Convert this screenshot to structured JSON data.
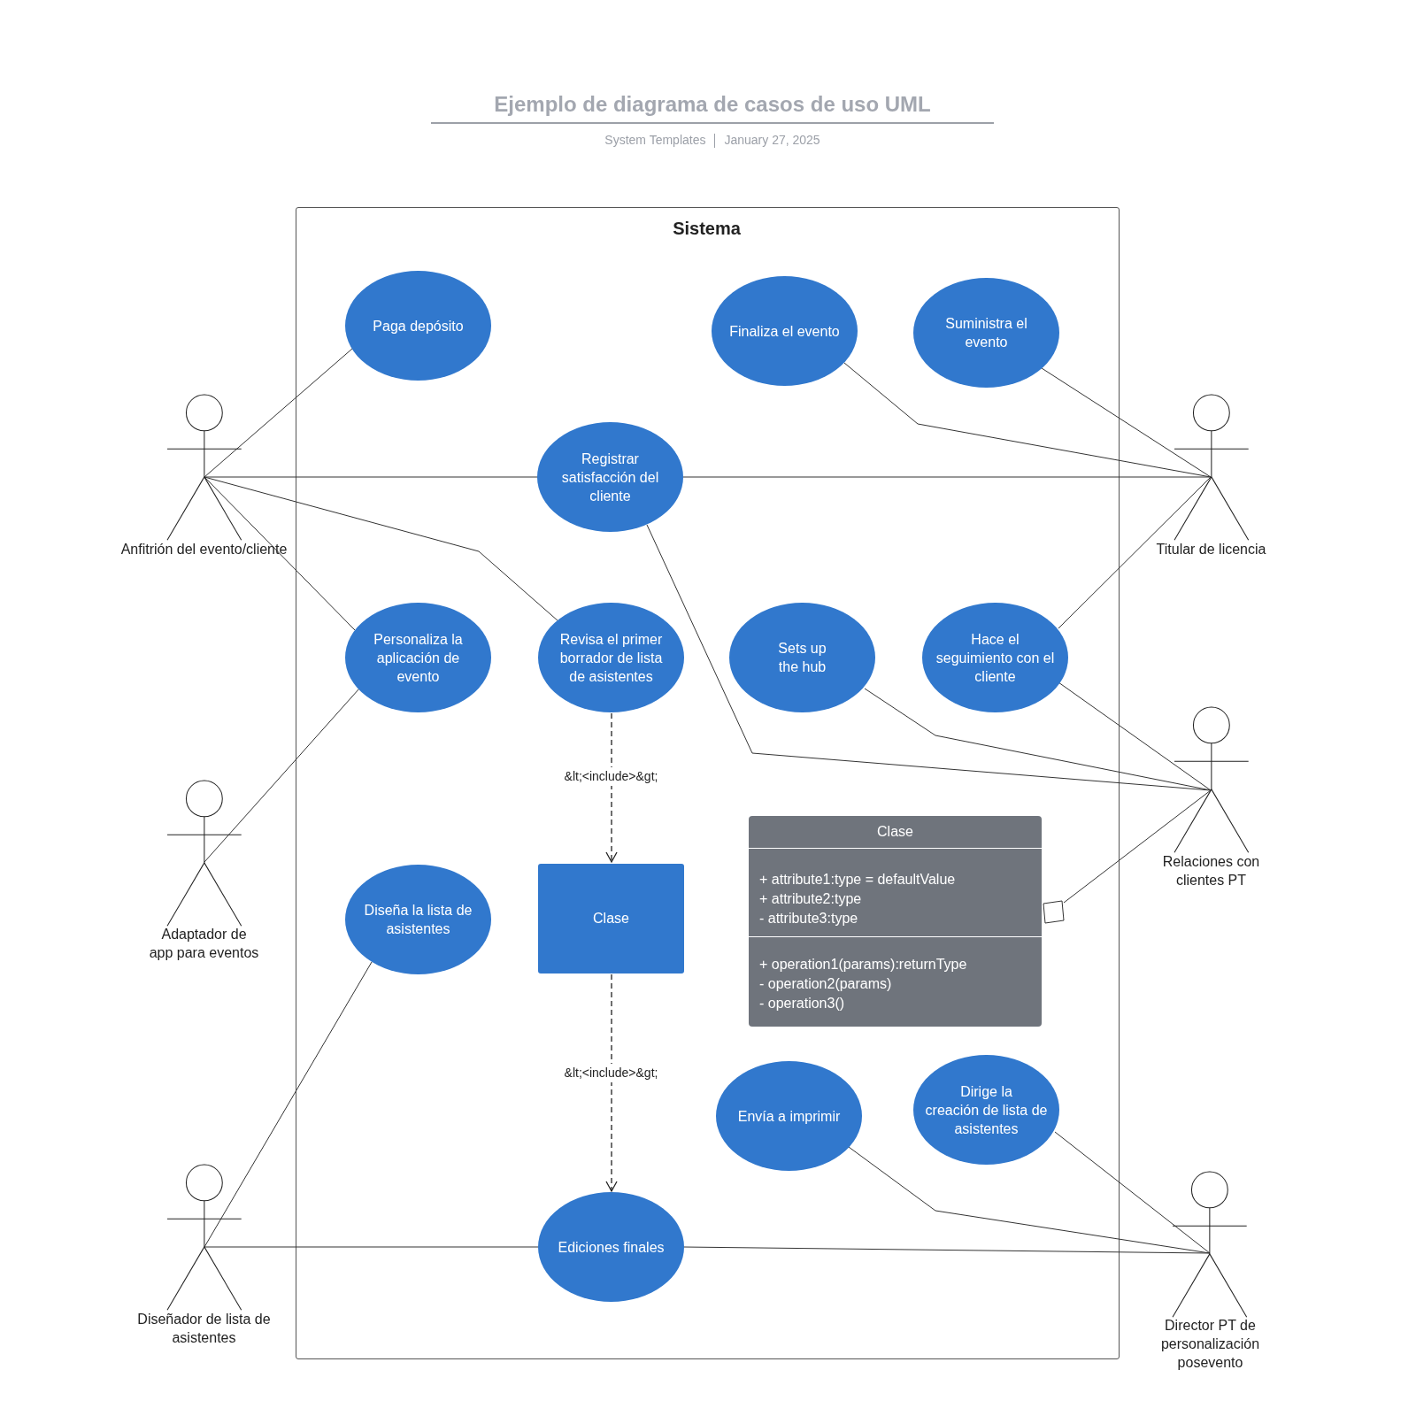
{
  "header": {
    "title": "Ejemplo de diagrama de casos de uso UML",
    "source": "System Templates",
    "date": "January 27, 2025"
  },
  "system": {
    "label": "Sistema"
  },
  "use_cases": [
    "Paga depósito",
    "Finaliza el evento",
    "Suministra el\nevento",
    "Registrar\nsatisfacción del\ncliente",
    "Personaliza la\naplicación de\nevento",
    "Revisa el primer\nborrador de lista\nde asistentes",
    "Sets up\nthe hub",
    "Hace el\nseguimiento con el\ncliente",
    "Diseña la lista de\nasistentes",
    "Envía a imprimir",
    "Dirige la\ncreación de lista de\nasistentes",
    "Ediciones finales"
  ],
  "class_shape": {
    "label": "Clase"
  },
  "class_box": {
    "title": "Clase",
    "attributes": [
      "+ attribute1:type = defaultValue",
      "+ attribute2:type",
      "- attribute3:type"
    ],
    "operations": [
      "+ operation1(params):returnType",
      "- operation2(params)",
      "- operation3()"
    ]
  },
  "include_labels": [
    "&lt;<include>&gt;",
    "&lt;<include>&gt;"
  ],
  "actors": [
    "Anfitrión del evento/cliente",
    "Titular de licencia",
    "Relaciones con\nclientes PT",
    "Adaptador de\napp para eventos",
    "Diseñador de lista de\nasistentes",
    "Director PT de\npersonalización\nposevento"
  ]
}
